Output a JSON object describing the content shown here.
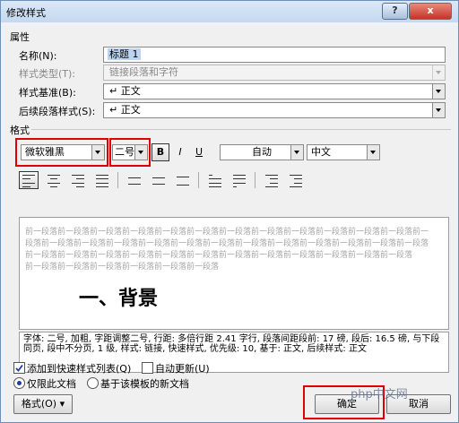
{
  "window": {
    "title": "修改样式",
    "help_symbol": "?",
    "close_symbol": "x"
  },
  "properties": {
    "group_label": "属性",
    "name_label": "名称(N):",
    "name_value": "标题 1",
    "style_type_label": "样式类型(T):",
    "style_type_value": "链接段落和字符",
    "based_on_label": "样式基准(B):",
    "based_on_value": "↵ 正文",
    "next_style_label": "后续段落样式(S):",
    "next_style_value": "↵ 正文"
  },
  "format": {
    "group_label": "格式",
    "font": "微软雅黑",
    "size": "二号",
    "bold": "B",
    "italic": "I",
    "underline": "U",
    "color": "自动",
    "script": "中文"
  },
  "preview": {
    "prev_paragraph_lines": [
      "前一段落前一段落前一段落前一段落前一段落前一段落前一段落前一段落前一段落前一段落前一段落前一段落前一",
      "段落前一段落前一段落前一段落前一段落前一段落前一段落前一段落前一段落前一段落前一段落前一段落前一段落",
      "前一段落前一段落前一段落前一段落前一段落前一段落前一段落前一段落前一段落前一段落前一段落前一段落",
      "前一段落前一段落前一段落前一段落前一段落前一段落"
    ],
    "sample_heading": "一、背景"
  },
  "description": "字体: 二号, 加粗, 字距调整二号, 行距: 多倍行距 2.41 字行, 段落间距段前: 17 磅, 段后: 16.5 磅, 与下段同页, 段中不分页, 1 级, 样式: 链接, 快速样式, 优先级: 10, 基于: 正文, 后续样式: 正文",
  "options": {
    "add_to_quick_styles": "添加到快速样式列表(Q)",
    "add_to_quick_styles_checked": true,
    "auto_update": "自动更新(U)",
    "auto_update_checked": false,
    "only_this_doc": "仅限此文档",
    "only_this_doc_selected": true,
    "new_docs_template": "基于该模板的新文档"
  },
  "buttons": {
    "format": "格式(O) ▾",
    "ok": "确定",
    "cancel": "取消"
  },
  "watermark": "php中文网"
}
